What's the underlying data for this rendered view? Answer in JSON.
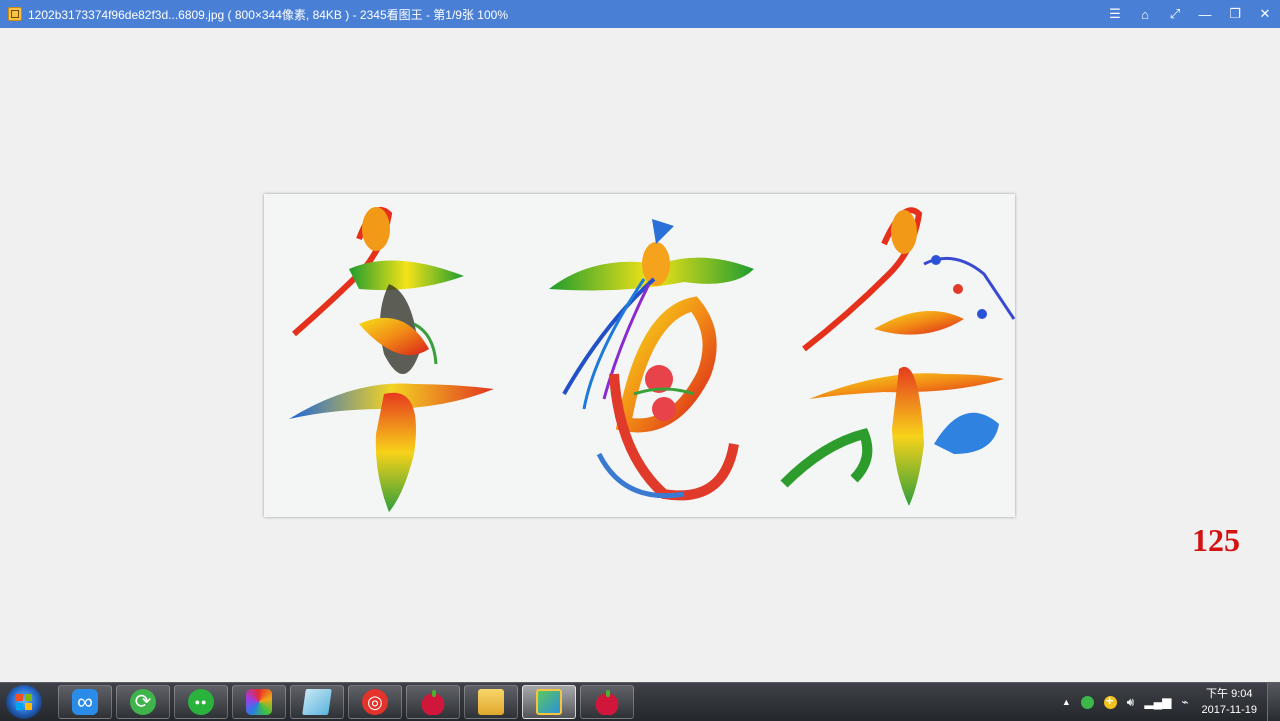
{
  "window": {
    "title": "1202b3173374f96de82f3d...6809.jpg ( 800×344像素, 84KB ) - 2345看图王 - 第1/9张 100%",
    "controls": [
      {
        "name": "menu-button",
        "icon": "☰"
      },
      {
        "name": "skin-button",
        "icon": "⌂"
      },
      {
        "name": "fullscreen-button",
        "icon": "⤢"
      },
      {
        "name": "minimize-button",
        "icon": "—"
      },
      {
        "name": "restore-button",
        "icon": "❐"
      },
      {
        "name": "close-button",
        "icon": "✕"
      }
    ]
  },
  "viewer": {
    "page_number": "125",
    "accent_color": "#d31212"
  },
  "taskbar": {
    "apps": [
      {
        "name": "baidu-netdisk",
        "icon": "cloud-icon"
      },
      {
        "name": "refresh-app",
        "icon": "refresh-icon"
      },
      {
        "name": "wechat",
        "icon": "chat-icon"
      },
      {
        "name": "paint-app",
        "icon": "colors-icon"
      },
      {
        "name": "notes-app",
        "icon": "paper-icon"
      },
      {
        "name": "netease-music",
        "icon": "music-icon"
      },
      {
        "name": "apple-app",
        "icon": "apple-icon"
      },
      {
        "name": "file-explorer",
        "icon": "folder-icon"
      },
      {
        "name": "image-viewer",
        "icon": "viewer-icon",
        "active": true
      },
      {
        "name": "apple-app-2",
        "icon": "apple-icon"
      }
    ],
    "tray": {
      "expand": "▲",
      "clock_time": "下午 9:04",
      "clock_date": "2017-11-19"
    }
  }
}
